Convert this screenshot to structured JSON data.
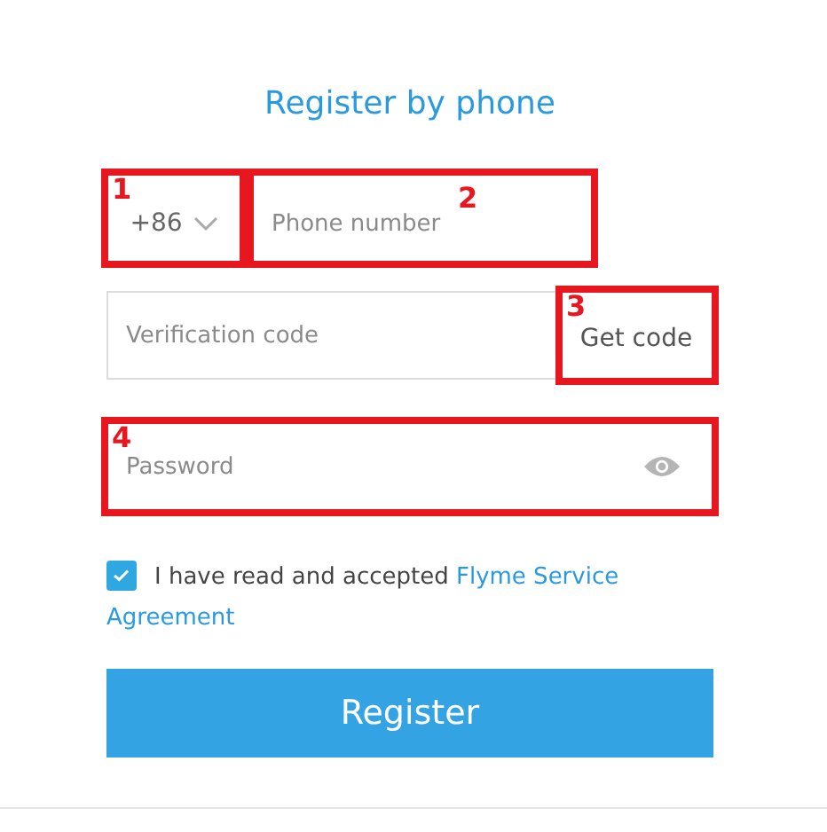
{
  "title": "Register by phone",
  "country_code": {
    "value": "+86",
    "annotation": "1"
  },
  "phone": {
    "placeholder": "Phone number",
    "annotation": "2"
  },
  "verification": {
    "placeholder": "Verification code"
  },
  "get_code": {
    "label": "Get code",
    "annotation": "3"
  },
  "password": {
    "placeholder": "Password",
    "annotation": "4"
  },
  "agreement": {
    "checked": true,
    "text": "I have read and accepted ",
    "link_lines": [
      "Flyme Service",
      "Agreement"
    ]
  },
  "register_button": "Register"
}
